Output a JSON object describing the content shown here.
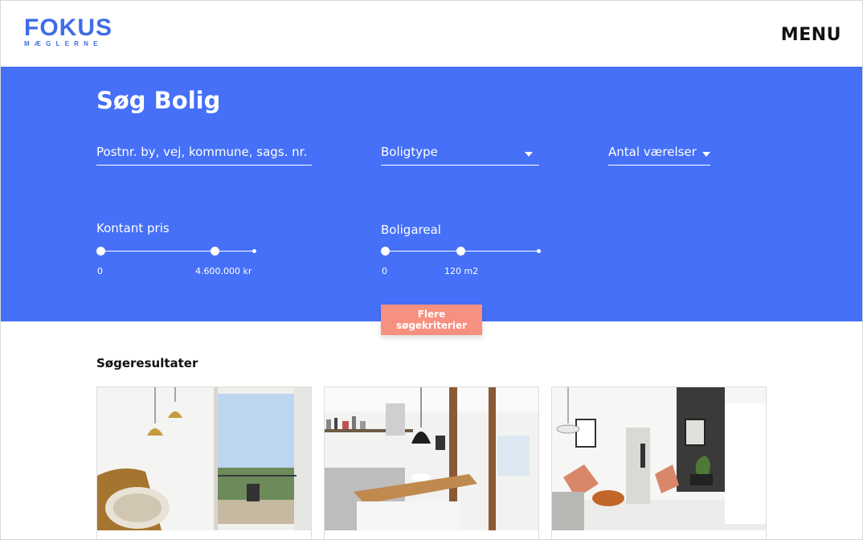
{
  "header": {
    "logo_main": "FOKUS",
    "logo_sub": "MÆGLERNE",
    "menu_label": "MENU"
  },
  "search": {
    "title": "Søg Bolig",
    "location_placeholder": "Postnr. by, vej, kommune, sags. nr.",
    "property_type_label": "Boligtype",
    "rooms_label": "Antal værelser",
    "price": {
      "label": "Kontant pris",
      "min_label": "0",
      "max_label": "4.600.000 kr",
      "handle_fraction": 0.74
    },
    "area": {
      "label": "Boligareal",
      "min_label": "0",
      "max_label": "120 m2",
      "handle_fraction": 0.49
    },
    "more_criteria_label": "Flere søgekriterier"
  },
  "results": {
    "title": "Søgeresultater",
    "listings": [
      {
        "image": "living-room-balcony-photo"
      },
      {
        "image": "kitchen-island-photo"
      },
      {
        "image": "living-room-chairs-photo"
      }
    ]
  },
  "colors": {
    "brand_blue": "#4570f7",
    "logo_blue": "#3f6ce8",
    "accent_salmon": "#f7907f"
  }
}
